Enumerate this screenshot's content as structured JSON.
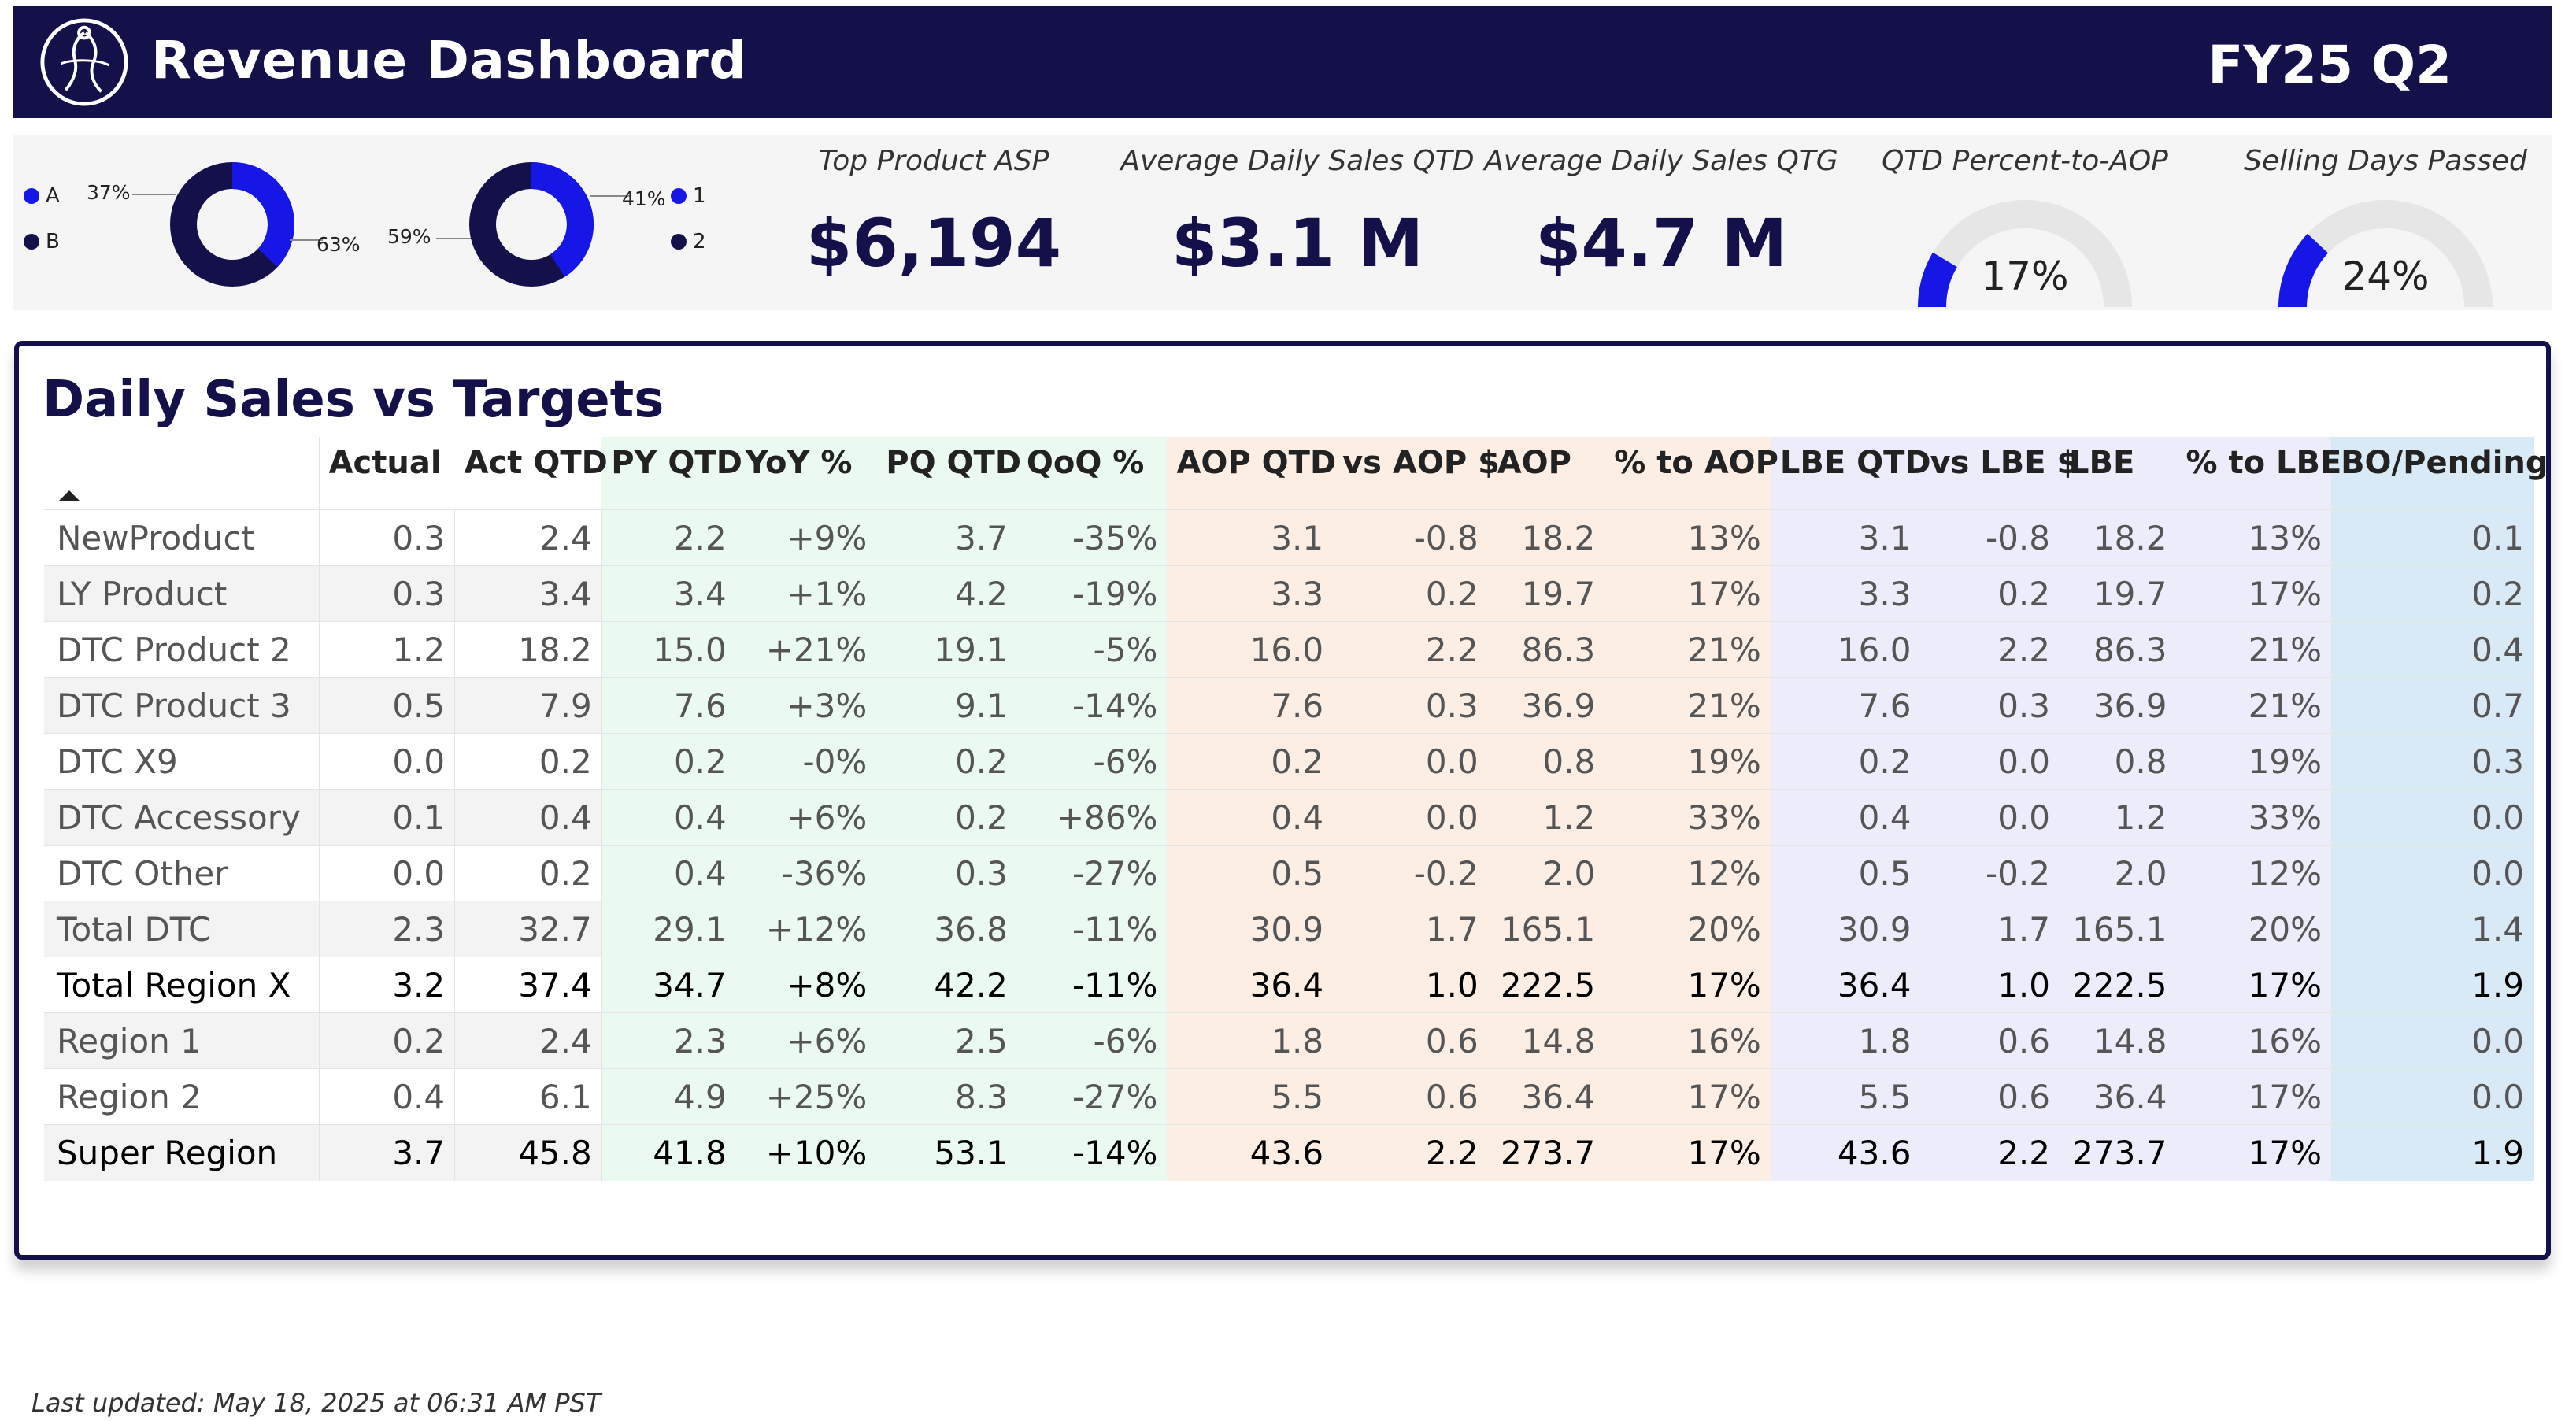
{
  "header": {
    "title": "Revenue Dashboard",
    "period": "FY25 Q2",
    "logo_icon": "figure-in-circle-logo"
  },
  "colors": {
    "navy": "#13104a",
    "blue": "#1616e6",
    "py_bg": "#eafaf1",
    "aop_bg": "#fdeee3",
    "lbe_bg": "#ececfb",
    "bo_bg": "#d9eaf7"
  },
  "donut1": {
    "legend": [
      {
        "label": "A",
        "color": "#1616e6"
      },
      {
        "label": "B",
        "color": "#13104a"
      }
    ],
    "a_pct": "37%",
    "b_pct": "63%",
    "a_value": 0.37
  },
  "donut2": {
    "legend": [
      {
        "label": "1",
        "color": "#1616e6"
      },
      {
        "label": "2",
        "color": "#13104a"
      }
    ],
    "one_pct": "41%",
    "two_pct": "59%",
    "one_value": 0.41
  },
  "kpis": [
    {
      "label": "Top Product ASP",
      "value": "$6,194"
    },
    {
      "label": "Average Daily Sales QTD",
      "value": "$3.1 M"
    },
    {
      "label": "Average Daily Sales QTG",
      "value": "$4.7 M"
    }
  ],
  "gauges": [
    {
      "label": "QTD Percent-to-AOP",
      "value": "17%",
      "fraction": 0.17
    },
    {
      "label": "Selling Days Passed",
      "value": "24%",
      "fraction": 0.24
    }
  ],
  "table": {
    "title": "Daily Sales vs Targets",
    "columns": [
      "",
      "Actual",
      "Act QTD",
      "PY QTD",
      "YoY %",
      "PQ QTD",
      "QoQ %",
      "AOP QTD",
      "vs AOP $",
      "AOP",
      "% to AOP",
      "LBE QTD",
      "vs LBE $",
      "LBE",
      "% to LBE",
      "BO/Pending"
    ],
    "rows": [
      {
        "name": "NewProduct",
        "bold": false,
        "values": [
          "0.3",
          "2.4",
          "2.2",
          "+9%",
          "3.7",
          "-35%",
          "3.1",
          "-0.8",
          "18.2",
          "13%",
          "3.1",
          "-0.8",
          "18.2",
          "13%",
          "0.1"
        ]
      },
      {
        "name": "LY Product",
        "bold": false,
        "values": [
          "0.3",
          "3.4",
          "3.4",
          "+1%",
          "4.2",
          "-19%",
          "3.3",
          "0.2",
          "19.7",
          "17%",
          "3.3",
          "0.2",
          "19.7",
          "17%",
          "0.2"
        ]
      },
      {
        "name": "DTC Product 2",
        "bold": false,
        "values": [
          "1.2",
          "18.2",
          "15.0",
          "+21%",
          "19.1",
          "-5%",
          "16.0",
          "2.2",
          "86.3",
          "21%",
          "16.0",
          "2.2",
          "86.3",
          "21%",
          "0.4"
        ]
      },
      {
        "name": "DTC Product 3",
        "bold": false,
        "values": [
          "0.5",
          "7.9",
          "7.6",
          "+3%",
          "9.1",
          "-14%",
          "7.6",
          "0.3",
          "36.9",
          "21%",
          "7.6",
          "0.3",
          "36.9",
          "21%",
          "0.7"
        ]
      },
      {
        "name": "DTC X9",
        "bold": false,
        "values": [
          "0.0",
          "0.2",
          "0.2",
          "-0%",
          "0.2",
          "-6%",
          "0.2",
          "0.0",
          "0.8",
          "19%",
          "0.2",
          "0.0",
          "0.8",
          "19%",
          "0.3"
        ]
      },
      {
        "name": "DTC Accessory",
        "bold": false,
        "values": [
          "0.1",
          "0.4",
          "0.4",
          "+6%",
          "0.2",
          "+86%",
          "0.4",
          "0.0",
          "1.2",
          "33%",
          "0.4",
          "0.0",
          "1.2",
          "33%",
          "0.0"
        ]
      },
      {
        "name": "DTC Other",
        "bold": false,
        "values": [
          "0.0",
          "0.2",
          "0.4",
          "-36%",
          "0.3",
          "-27%",
          "0.5",
          "-0.2",
          "2.0",
          "12%",
          "0.5",
          "-0.2",
          "2.0",
          "12%",
          "0.0"
        ]
      },
      {
        "name": "Total DTC",
        "bold": false,
        "values": [
          "2.3",
          "32.7",
          "29.1",
          "+12%",
          "36.8",
          "-11%",
          "30.9",
          "1.7",
          "165.1",
          "20%",
          "30.9",
          "1.7",
          "165.1",
          "20%",
          "1.4"
        ]
      },
      {
        "name": "Total Region X",
        "bold": true,
        "values": [
          "3.2",
          "37.4",
          "34.7",
          "+8%",
          "42.2",
          "-11%",
          "36.4",
          "1.0",
          "222.5",
          "17%",
          "36.4",
          "1.0",
          "222.5",
          "17%",
          "1.9"
        ]
      },
      {
        "name": "Region 1",
        "bold": false,
        "values": [
          "0.2",
          "2.4",
          "2.3",
          "+6%",
          "2.5",
          "-6%",
          "1.8",
          "0.6",
          "14.8",
          "16%",
          "1.8",
          "0.6",
          "14.8",
          "16%",
          "0.0"
        ]
      },
      {
        "name": "Region 2",
        "bold": false,
        "values": [
          "0.4",
          "6.1",
          "4.9",
          "+25%",
          "8.3",
          "-27%",
          "5.5",
          "0.6",
          "36.4",
          "17%",
          "5.5",
          "0.6",
          "36.4",
          "17%",
          "0.0"
        ]
      },
      {
        "name": "Super Region",
        "bold": true,
        "values": [
          "3.7",
          "45.8",
          "41.8",
          "+10%",
          "53.1",
          "-14%",
          "43.6",
          "2.2",
          "273.7",
          "17%",
          "43.6",
          "2.2",
          "273.7",
          "17%",
          "1.9"
        ]
      }
    ]
  },
  "footer": {
    "last_updated": "Last updated: May 18, 2025 at 06:31 AM PST"
  }
}
